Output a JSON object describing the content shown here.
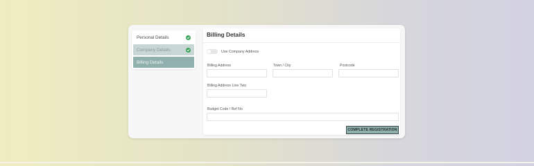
{
  "sidebar": {
    "items": [
      {
        "label": "Personal Details",
        "state": "complete"
      },
      {
        "label": "Company Details",
        "state": "complete"
      },
      {
        "label": "Billing Details",
        "state": "active"
      }
    ]
  },
  "panel": {
    "title": "Billing Details",
    "use_company_address_label": "Use Company Address",
    "use_company_address_on": false
  },
  "fields": {
    "billing_address": {
      "label": "Billing Address",
      "value": ""
    },
    "town_city": {
      "label": "Town / City",
      "value": ""
    },
    "postcode": {
      "label": "Postcode",
      "value": ""
    },
    "billing_address_two": {
      "label": "Billing Address Line Two",
      "value": ""
    },
    "budget_code": {
      "label": "Budget Code / Ref No",
      "value": ""
    }
  },
  "actions": {
    "complete_label": "COMPLETE REGISTRATION"
  },
  "colors": {
    "accent": "#8fb0ad",
    "check": "#3aa35a"
  },
  "icons": {
    "check": "check-circle-icon"
  }
}
